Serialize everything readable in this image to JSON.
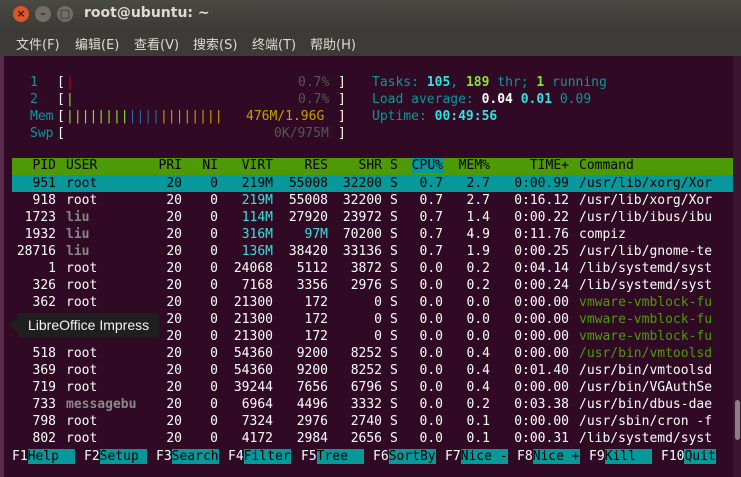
{
  "window": {
    "title": "root@ubuntu: ~"
  },
  "menu": [
    "文件(F)",
    "编辑(E)",
    "查看(V)",
    "搜索(S)",
    "终端(T)",
    "帮助(H)"
  ],
  "meters": {
    "cpu1": {
      "label": "1",
      "bar": "|",
      "value": "0.7%"
    },
    "cpu2": {
      "label": "2",
      "bar": "|",
      "value": "0.7%"
    },
    "mem": {
      "label": "Mem",
      "bar": "||||||||||||||||||||",
      "value": "476M/1.96G"
    },
    "swp": {
      "label": "Swp",
      "bar": "",
      "value": "0K/975M"
    }
  },
  "summary": {
    "tasks_label": "Tasks: ",
    "tasks": "105",
    "thr": "189",
    "thr_label": " thr; ",
    "running": "1",
    "running_label": " running",
    "load_label": "Load average: ",
    "load1": "0.04",
    "load5": "0.01",
    "load15": "0.09",
    "uptime_label": "Uptime: ",
    "uptime": "00:49:56"
  },
  "columns": [
    "PID",
    "USER",
    "PRI",
    "NI",
    "VIRT",
    "RES",
    "SHR",
    "S",
    "CPU%",
    "MEM%",
    "TIME+",
    "Command"
  ],
  "processes": [
    {
      "pid": "951",
      "user": "root",
      "pri": "20",
      "ni": "0",
      "virt": "219M",
      "res": "55008",
      "shr": "32200",
      "s": "S",
      "cpu": "0.7",
      "mem": "2.7",
      "time": "0:00.99",
      "cmd": "/usr/lib/xorg/Xor",
      "selected": true
    },
    {
      "pid": "918",
      "user": "root",
      "pri": "20",
      "ni": "0",
      "virt": "219M",
      "res": "55008",
      "shr": "32200",
      "s": "S",
      "cpu": "0.7",
      "mem": "2.7",
      "time": "0:16.12",
      "cmd": "/usr/lib/xorg/Xor"
    },
    {
      "pid": "1723",
      "user": "liu",
      "pri": "20",
      "ni": "0",
      "virt": "114M",
      "res": "27920",
      "shr": "23972",
      "s": "S",
      "cpu": "0.7",
      "mem": "1.4",
      "time": "0:00.22",
      "cmd": "/usr/lib/ibus/ibu"
    },
    {
      "pid": "1932",
      "user": "liu",
      "pri": "20",
      "ni": "0",
      "virt": "316M",
      "res": "97M",
      "shr": "70200",
      "s": "S",
      "cpu": "0.7",
      "mem": "4.9",
      "time": "0:11.76",
      "cmd": "compiz"
    },
    {
      "pid": "28716",
      "user": "liu",
      "pri": "20",
      "ni": "0",
      "virt": "136M",
      "res": "38420",
      "shr": "33136",
      "s": "S",
      "cpu": "0.7",
      "mem": "1.9",
      "time": "0:00.25",
      "cmd": "/usr/lib/gnome-te"
    },
    {
      "pid": "1",
      "user": "root",
      "pri": "20",
      "ni": "0",
      "virt": "24068",
      "res": "5112",
      "shr": "3872",
      "s": "S",
      "cpu": "0.0",
      "mem": "0.2",
      "time": "0:04.14",
      "cmd": "/lib/systemd/syst"
    },
    {
      "pid": "326",
      "user": "root",
      "pri": "20",
      "ni": "0",
      "virt": "7168",
      "res": "3356",
      "shr": "2976",
      "s": "S",
      "cpu": "0.0",
      "mem": "0.2",
      "time": "0:00.24",
      "cmd": "/lib/systemd/syst"
    },
    {
      "pid": "362",
      "user": "root",
      "pri": "20",
      "ni": "0",
      "virt": "21300",
      "res": "172",
      "shr": "0",
      "s": "S",
      "cpu": "0.0",
      "mem": "0.0",
      "time": "0:00.00",
      "cmd": "vmware-vmblock-fu",
      "green": true
    },
    {
      "pid": "",
      "user": "",
      "pri": "20",
      "ni": "0",
      "virt": "21300",
      "res": "172",
      "shr": "0",
      "s": "S",
      "cpu": "0.0",
      "mem": "0.0",
      "time": "0:00.00",
      "cmd": "vmware-vmblock-fu",
      "green": true
    },
    {
      "pid": "",
      "user": "",
      "pri": "20",
      "ni": "0",
      "virt": "21300",
      "res": "172",
      "shr": "0",
      "s": "S",
      "cpu": "0.0",
      "mem": "0.0",
      "time": "0:00.00",
      "cmd": "vmware-vmblock-fu",
      "green": true
    },
    {
      "pid": "518",
      "user": "root",
      "pri": "20",
      "ni": "0",
      "virt": "54360",
      "res": "9200",
      "shr": "8252",
      "s": "S",
      "cpu": "0.0",
      "mem": "0.4",
      "time": "0:00.00",
      "cmd": "/usr/bin/vmtoolsd",
      "green": true
    },
    {
      "pid": "369",
      "user": "root",
      "pri": "20",
      "ni": "0",
      "virt": "54360",
      "res": "9200",
      "shr": "8252",
      "s": "S",
      "cpu": "0.0",
      "mem": "0.4",
      "time": "0:01.40",
      "cmd": "/usr/bin/vmtoolsd"
    },
    {
      "pid": "719",
      "user": "root",
      "pri": "20",
      "ni": "0",
      "virt": "39244",
      "res": "7656",
      "shr": "6796",
      "s": "S",
      "cpu": "0.0",
      "mem": "0.4",
      "time": "0:00.00",
      "cmd": "/usr/bin/VGAuthSe"
    },
    {
      "pid": "733",
      "user": "messagebu",
      "pri": "20",
      "ni": "0",
      "virt": "6964",
      "res": "4496",
      "shr": "3332",
      "s": "S",
      "cpu": "0.0",
      "mem": "0.2",
      "time": "0:03.38",
      "cmd": "/usr/bin/dbus-dae"
    },
    {
      "pid": "798",
      "user": "root",
      "pri": "20",
      "ni": "0",
      "virt": "7324",
      "res": "2976",
      "shr": "2740",
      "s": "S",
      "cpu": "0.0",
      "mem": "0.1",
      "time": "0:00.00",
      "cmd": "/usr/sbin/cron -f"
    },
    {
      "pid": "802",
      "user": "root",
      "pri": "20",
      "ni": "0",
      "virt": "4172",
      "res": "2984",
      "shr": "2656",
      "s": "S",
      "cpu": "0.0",
      "mem": "0.1",
      "time": "0:00.31",
      "cmd": "/lib/systemd/syst"
    }
  ],
  "fkeys": [
    {
      "key": "F1",
      "label": "Help  "
    },
    {
      "key": "F2",
      "label": "Setup "
    },
    {
      "key": "F3",
      "label": "Search"
    },
    {
      "key": "F4",
      "label": "Filter"
    },
    {
      "key": "F5",
      "label": "Tree  "
    },
    {
      "key": "F6",
      "label": "SortBy"
    },
    {
      "key": "F7",
      "label": "Nice -"
    },
    {
      "key": "F8",
      "label": "Nice +"
    },
    {
      "key": "F9",
      "label": "Kill  "
    },
    {
      "key": "F10",
      "label": "Quit"
    }
  ],
  "tooltip": "LibreOffice Impress"
}
